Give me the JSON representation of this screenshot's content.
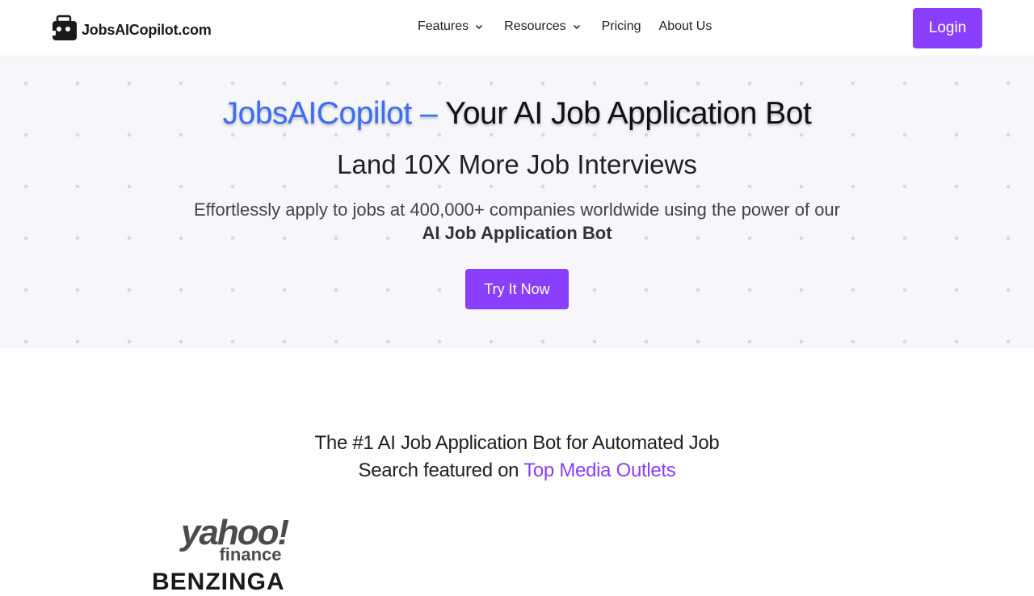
{
  "header": {
    "logo_text": "JobsAICopilot.com",
    "nav": {
      "features": "Features",
      "resources": "Resources",
      "pricing": "Pricing",
      "about": "About Us"
    },
    "login": "Login"
  },
  "hero": {
    "title_brand": "JobsAICopilot",
    "title_dash": " – ",
    "title_rest": "Your AI Job Application Bot",
    "subtitle": "Land 10X More Job Interviews",
    "desc_line1": "Effortlessly apply to jobs at 400,000+ companies worldwide using the power of our",
    "desc_line2": "AI Job Application Bot",
    "cta": "Try It Now"
  },
  "featured": {
    "line1": "The #1 AI Job Application Bot for Automated Job",
    "line2_prefix": "Search featured on ",
    "line2_accent": "Top Media Outlets"
  },
  "logos": {
    "yahoo_main": "yahoo!",
    "yahoo_sub": "finance",
    "benzinga": "BENZINGA"
  },
  "colors": {
    "accent_purple": "#8a3ffc",
    "brand_blue": "#3b6ef0",
    "hero_bg": "#f6f6fb"
  }
}
